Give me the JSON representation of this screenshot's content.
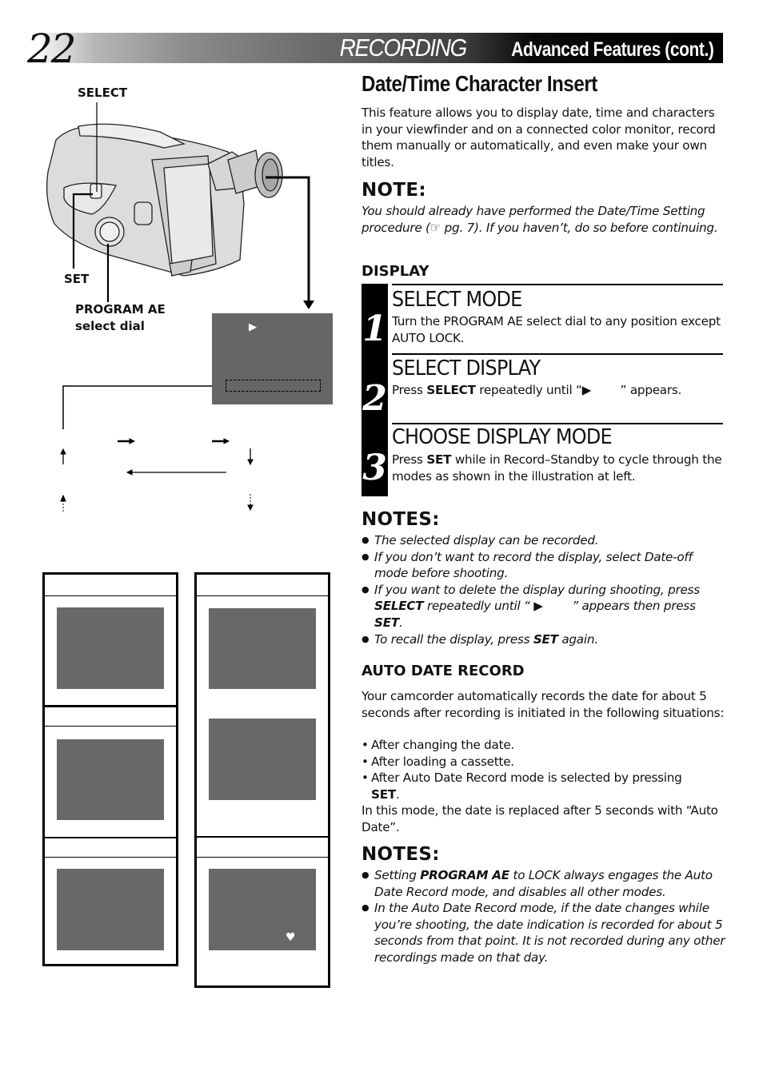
{
  "header": {
    "page_number": "22",
    "title_main": "RECORDING",
    "title_sub": "Advanced Features (cont.)"
  },
  "illustration": {
    "labels": {
      "select": "SELECT",
      "set": "SET",
      "program_ae_line1": "PROGRAM AE",
      "program_ae_line2": "select dial"
    },
    "viewfinder_indicator": "▶",
    "mode_screen_icon": "♥",
    "colors": {
      "screen": "#686868",
      "viewfinder": "#666666"
    }
  },
  "section": {
    "title": "Date/Time Character Insert",
    "intro": "This feature allows you to display date, time and characters in your viewfinder and on a connected color monitor, record them manually or automatically, and even make your own titles.",
    "note_heading": "NOTE:",
    "note_text": "You should already have performed the Date/Time Setting procedure (☞ pg. 7). If you haven’t, do so before continuing."
  },
  "display": {
    "heading": "DISPLAY",
    "steps": [
      {
        "number": "1",
        "title": "SELECT MODE",
        "text": "Turn the PROGRAM AE select dial to any position except AUTO LOCK."
      },
      {
        "number": "2",
        "title": "SELECT DISPLAY",
        "text_pre": "Press ",
        "text_bold": "SELECT",
        "text_post": " repeatedly until “▶        ” appears."
      },
      {
        "number": "3",
        "title": "CHOOSE DISPLAY MODE",
        "text_pre": "Press ",
        "text_bold": "SET",
        "text_post": " while in Record–Standby to cycle through the modes as shown in the illustration at left."
      }
    ]
  },
  "notes1": {
    "heading": "NOTES:",
    "items": [
      {
        "text": "The selected display can be recorded."
      },
      {
        "text": "If you don’t want to record the display, select Date-off mode before shooting."
      },
      {
        "pre": "If you want to delete the display during shooting, press ",
        "b1": "SELECT",
        "mid": " repeatedly until “ ▶        ” appears then press ",
        "b2": "SET",
        "post": "."
      },
      {
        "pre": "To recall the display, press ",
        "b1": "SET",
        "post": " again."
      }
    ]
  },
  "auto_date": {
    "heading": "AUTO DATE RECORD",
    "intro": "Your camcorder automatically records the date for about 5 seconds after recording is initiated in the following situations:",
    "items": [
      "After changing the date.",
      "After loading a cassette.",
      "After Auto Date Record mode is selected by pressing"
    ],
    "item3_bold": "SET",
    "outro": "In this mode, the date is replaced after 5 seconds with “Auto Date”."
  },
  "notes2": {
    "heading": "NOTES:",
    "items": [
      {
        "pre": "Setting ",
        "b1": "PROGRAM AE",
        "post": " to LOCK always engages the Auto Date Record mode, and disables all other modes."
      },
      {
        "text": "In the Auto Date Record mode, if the date changes while you’re shooting, the date indication is recorded for about 5 seconds from that point. It is not recorded during any other recordings made on that day."
      }
    ]
  }
}
